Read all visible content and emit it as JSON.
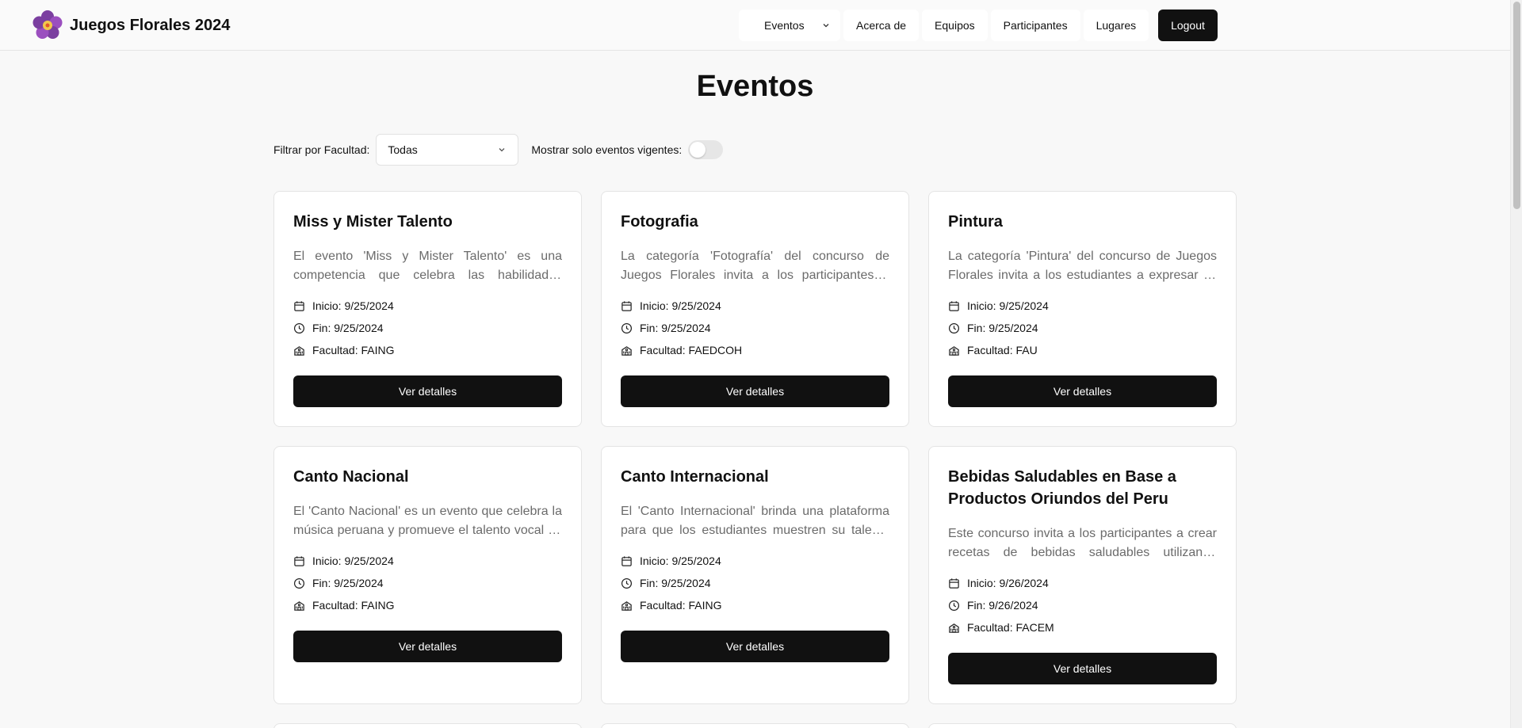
{
  "header": {
    "brand": "Juegos Florales 2024",
    "nav": [
      "Eventos",
      "Acerca de",
      "Equipos",
      "Participantes",
      "Lugares"
    ],
    "logout": "Logout"
  },
  "page": {
    "title": "Eventos",
    "filter_label": "Filtrar por Facultad:",
    "filter_value": "Todas",
    "vigentes_label": "Mostrar solo eventos vigentes:",
    "vigentes_on": false
  },
  "cards": [
    {
      "title": "Miss y Mister Talento",
      "desc": "El evento 'Miss y Mister Talento' es una competencia que celebra las habilidades artísticas y el carisma de los estudiantes.",
      "inicio": "Inicio: 9/25/2024",
      "fin": "Fin: 9/25/2024",
      "facultad": "Facultad: FAING",
      "button": "Ver detalles"
    },
    {
      "title": "Fotografia",
      "desc": "La categoría 'Fotografía' del concurso de Juegos Florales invita a los participantes a capturar momentos únicos.",
      "inicio": "Inicio: 9/25/2024",
      "fin": "Fin: 9/25/2024",
      "facultad": "Facultad: FAEDCOH",
      "button": "Ver detalles"
    },
    {
      "title": "Pintura",
      "desc": "La categoría 'Pintura' del concurso de Juegos Florales invita a los estudiantes a expresar su creatividad.",
      "inicio": "Inicio: 9/25/2024",
      "fin": "Fin: 9/25/2024",
      "facultad": "Facultad: FAU",
      "button": "Ver detalles"
    },
    {
      "title": "Canto Nacional",
      "desc": "El 'Canto Nacional' es un evento que celebra la música peruana y promueve el talento vocal de los estudiantes.",
      "inicio": "Inicio: 9/25/2024",
      "fin": "Fin: 9/25/2024",
      "facultad": "Facultad: FAING",
      "button": "Ver detalles"
    },
    {
      "title": "Canto Internacional",
      "desc": "El 'Canto Internacional' brinda una plataforma para que los estudiantes muestren su talento interpretando canciones.",
      "inicio": "Inicio: 9/25/2024",
      "fin": "Fin: 9/25/2024",
      "facultad": "Facultad: FAING",
      "button": "Ver detalles"
    },
    {
      "title": "Bebidas Saludables en Base a Productos Oriundos del Peru",
      "desc": "Este concurso invita a los participantes a crear recetas de bebidas saludables utilizando productos peruanos.",
      "inicio": "Inicio: 9/26/2024",
      "fin": "Fin: 9/26/2024",
      "facultad": "Facultad: FACEM",
      "button": "Ver detalles"
    }
  ]
}
